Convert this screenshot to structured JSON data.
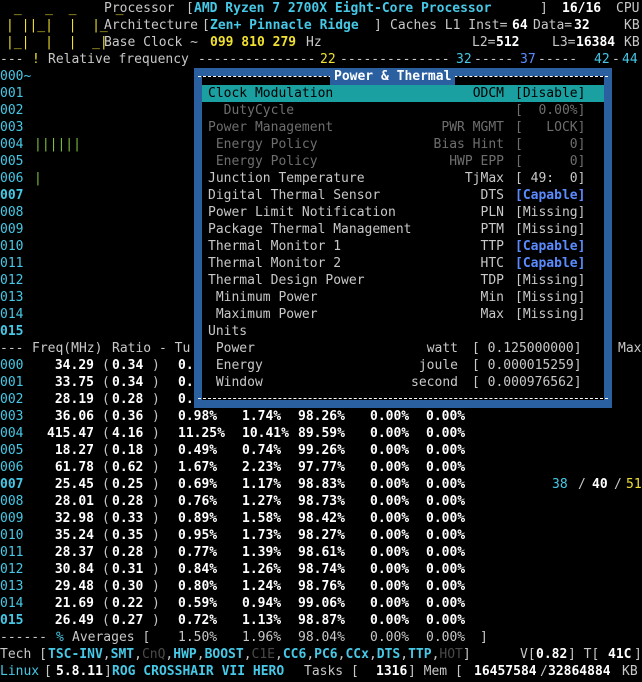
{
  "header": {
    "processor_label": "Processor",
    "processor_name": "AMD Ryzen 7 2700X Eight-Core Processor",
    "threads": "16/16",
    "cpu_label": "CPU",
    "arch_label": "Architecture",
    "arch_name": "Zen+ Pinnacle Ridge",
    "caches_label": "Caches L1 Inst=",
    "l1_inst": "64",
    "data_label": "Data=",
    "l1_data": "32",
    "kb1": "KB",
    "base_clock_label": "Base Clock ~",
    "base_clock_value": "099 810 279",
    "hz": "Hz",
    "l2_label": "L2=",
    "l2": "512",
    "l3_label": "L3=",
    "l3": "16384",
    "kb2": "KB",
    "rel_freq_label": "Relative frequency",
    "scale_marks": [
      "22",
      "32",
      "37",
      "42",
      "44"
    ]
  },
  "cpu_rows": [
    "000~",
    "001",
    "002",
    "003",
    "004",
    "005",
    "006",
    "007",
    "008",
    "009",
    "010",
    "011",
    "012",
    "013",
    "014",
    "015"
  ],
  "bars": {
    "004": "||||||",
    "006": "|"
  },
  "popup": {
    "title": "Power & Thermal",
    "items": [
      {
        "label": "Clock Modulation",
        "abbr": "ODCM",
        "value": "[Disable]",
        "state": "selected"
      },
      {
        "label": "  DutyCycle",
        "abbr": "",
        "value": "[  0.00%]",
        "state": "dim"
      },
      {
        "label": "Power Management",
        "abbr": "PWR MGMT",
        "value": "[   LOCK]",
        "state": "dim"
      },
      {
        "label": " Energy Policy",
        "abbr": "Bias Hint",
        "value": "[      0]",
        "state": "dim"
      },
      {
        "label": " Energy Policy",
        "abbr": "HWP EPP",
        "value": "[      0]",
        "state": "dim"
      },
      {
        "label": "Junction Temperature",
        "abbr": "TjMax",
        "value": "[ 49:  0]",
        "state": "normal"
      },
      {
        "label": "Digital Thermal Sensor",
        "abbr": "DTS",
        "value": "[Capable]",
        "state": "capable"
      },
      {
        "label": "Power Limit Notification",
        "abbr": "PLN",
        "value": "[Missing]",
        "state": "normal"
      },
      {
        "label": "Package Thermal Management",
        "abbr": "PTM",
        "value": "[Missing]",
        "state": "normal"
      },
      {
        "label": "Thermal Monitor 1",
        "abbr": "TTP",
        "value": "[Capable]",
        "state": "capable"
      },
      {
        "label": "Thermal Monitor 2",
        "abbr": "HTC",
        "value": "[Capable]",
        "state": "capable"
      },
      {
        "label": "Thermal Design Power",
        "abbr": "TDP",
        "value": "[Missing]",
        "state": "normal"
      },
      {
        "label": " Minimum Power",
        "abbr": "Min",
        "value": "[Missing]",
        "state": "normal"
      },
      {
        "label": " Maximum Power",
        "abbr": "Max",
        "value": "[Missing]",
        "state": "normal"
      },
      {
        "label": "Units",
        "abbr": "",
        "value": "",
        "state": "normal"
      },
      {
        "label": " Power",
        "abbr": "watt",
        "value": "[ 0.125000000]",
        "state": "normal"
      },
      {
        "label": " Energy",
        "abbr": "joule",
        "value": "[ 0.000015259]",
        "state": "normal"
      },
      {
        "label": " Window",
        "abbr": "second",
        "value": "[ 0.000976562]",
        "state": "normal"
      }
    ]
  },
  "freq_header": {
    "prefix": "--- ",
    "freq": "Freq(MHz)",
    "ratio": "Ratio - Tu",
    "max": "Max"
  },
  "freq_rows": [
    {
      "cpu": "000",
      "freq": "34.29",
      "ratio": "0.34",
      "c0": "0.",
      "c1": "",
      "c3": "",
      "c6": "",
      "c7": "",
      "temp": ""
    },
    {
      "cpu": "001",
      "freq": "33.75",
      "ratio": "0.34",
      "c0": "0.",
      "c1": "",
      "c3": "",
      "c6": "",
      "c7": "",
      "temp": ""
    },
    {
      "cpu": "002",
      "freq": "28.19",
      "ratio": "0.28",
      "c0": "0.",
      "c1": "",
      "c3": "",
      "c6": "",
      "c7": "",
      "temp": ""
    },
    {
      "cpu": "003",
      "freq": "36.06",
      "ratio": "0.36",
      "c0": "0.98%",
      "c1": "1.74%",
      "c3": "98.26%",
      "c6": "0.00%",
      "c7": "0.00%",
      "temp": ""
    },
    {
      "cpu": "004",
      "freq": "415.47",
      "ratio": "4.16",
      "c0": "11.25%",
      "c1": "10.41%",
      "c3": "89.59%",
      "c6": "0.00%",
      "c7": "0.00%",
      "temp": ""
    },
    {
      "cpu": "005",
      "freq": "18.27",
      "ratio": "0.18",
      "c0": "0.49%",
      "c1": "0.74%",
      "c3": "99.26%",
      "c6": "0.00%",
      "c7": "0.00%",
      "temp": ""
    },
    {
      "cpu": "006",
      "freq": "61.78",
      "ratio": "0.62",
      "c0": "1.67%",
      "c1": "2.23%",
      "c3": "97.77%",
      "c6": "0.00%",
      "c7": "0.00%",
      "temp": ""
    },
    {
      "cpu": "007",
      "freq": "25.45",
      "ratio": "0.25",
      "c0": "0.69%",
      "c1": "1.17%",
      "c3": "98.83%",
      "c6": "0.00%",
      "c7": "0.00%",
      "temp": "38 / 40 / 51"
    },
    {
      "cpu": "008",
      "freq": "28.01",
      "ratio": "0.28",
      "c0": "0.76%",
      "c1": "1.27%",
      "c3": "98.73%",
      "c6": "0.00%",
      "c7": "0.00%",
      "temp": ""
    },
    {
      "cpu": "009",
      "freq": "32.98",
      "ratio": "0.33",
      "c0": "0.89%",
      "c1": "1.58%",
      "c3": "98.42%",
      "c6": "0.00%",
      "c7": "0.00%",
      "temp": ""
    },
    {
      "cpu": "010",
      "freq": "35.24",
      "ratio": "0.35",
      "c0": "0.95%",
      "c1": "1.73%",
      "c3": "98.27%",
      "c6": "0.00%",
      "c7": "0.00%",
      "temp": ""
    },
    {
      "cpu": "011",
      "freq": "28.37",
      "ratio": "0.28",
      "c0": "0.77%",
      "c1": "1.39%",
      "c3": "98.61%",
      "c6": "0.00%",
      "c7": "0.00%",
      "temp": ""
    },
    {
      "cpu": "012",
      "freq": "30.84",
      "ratio": "0.31",
      "c0": "0.84%",
      "c1": "1.26%",
      "c3": "98.74%",
      "c6": "0.00%",
      "c7": "0.00%",
      "temp": ""
    },
    {
      "cpu": "013",
      "freq": "29.48",
      "ratio": "0.30",
      "c0": "0.80%",
      "c1": "1.24%",
      "c3": "98.76%",
      "c6": "0.00%",
      "c7": "0.00%",
      "temp": ""
    },
    {
      "cpu": "014",
      "freq": "21.69",
      "ratio": "0.22",
      "c0": "0.59%",
      "c1": "0.94%",
      "c3": "99.06%",
      "c6": "0.00%",
      "c7": "0.00%",
      "temp": ""
    },
    {
      "cpu": "015",
      "freq": "26.49",
      "ratio": "0.27",
      "c0": "0.72%",
      "c1": "1.13%",
      "c3": "98.87%",
      "c6": "0.00%",
      "c7": "0.00%",
      "temp": ""
    }
  ],
  "averages": {
    "prefix": "------",
    "pct": "%",
    "label": "Averages [",
    "c0": "1.50%",
    "c1": "1.96%",
    "c3": "98.04%",
    "c6": "0.00%",
    "c7": "0.00%",
    "end": "]"
  },
  "tech": {
    "label": "Tech [",
    "items": [
      {
        "text": "TSC-INV",
        "on": true
      },
      {
        "text": "SMT",
        "on": true
      },
      {
        "text": "CnQ",
        "on": false
      },
      {
        "text": "HWP",
        "on": true
      },
      {
        "text": "BOOST",
        "on": true
      },
      {
        "text": "C1E",
        "on": false
      },
      {
        "text": "CC6",
        "on": true
      },
      {
        "text": "PC6",
        "on": true
      },
      {
        "text": "CCx",
        "on": true
      },
      {
        "text": "DTS",
        "on": true
      },
      {
        "text": "TTP",
        "on": true
      },
      {
        "text": "HOT",
        "on": false
      }
    ],
    "close": "]",
    "v_label": "V[",
    "voltage": "0.82",
    "t_label": "] T[",
    "temp": "41C"
  },
  "footer": {
    "os": "Linux",
    "kernel": "5.8.11",
    "board": "ROG CROSSHAIR VII HERO",
    "tasks_label": "Tasks [",
    "tasks": "1316",
    "mem_label": "] Mem [",
    "mem_used": "16457584",
    "mem_total": "32864884",
    "kb": "KB"
  }
}
